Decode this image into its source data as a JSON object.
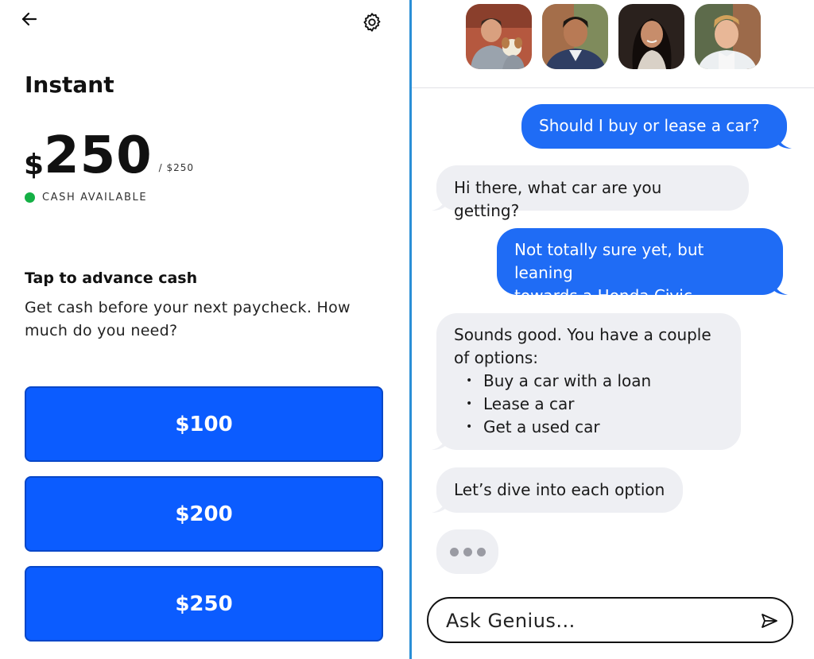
{
  "left": {
    "title": "Instant",
    "currency_symbol": "$",
    "balance": "250",
    "limit": "/ $250",
    "status_label": "CASH AVAILABLE",
    "status_color": "#14b045",
    "section_title": "Tap to advance cash",
    "description": "Get cash before your next paycheck. How much do you need?",
    "amount_buttons": [
      {
        "label": "$100"
      },
      {
        "label": "$200"
      },
      {
        "label": "$250"
      }
    ],
    "accent_color": "#0b5cff",
    "icons": {
      "back": "arrow-left-icon",
      "settings": "gear-icon"
    }
  },
  "right": {
    "advisors": [
      "advisor-1",
      "advisor-2",
      "advisor-3",
      "advisor-4"
    ],
    "messages": [
      {
        "from": "user",
        "text": "Should I buy or lease a car?"
      },
      {
        "from": "assistant",
        "text": "Hi there, what car are you getting?"
      },
      {
        "from": "user",
        "lines": [
          "Not totally sure yet, but leaning",
          "towards a Honda Civic"
        ]
      },
      {
        "from": "assistant",
        "lines": [
          "Sounds good. You have a couple",
          "of options:"
        ],
        "bullets": [
          "Buy a car with a loan",
          "Lease a car",
          "Get a used car"
        ]
      },
      {
        "from": "assistant",
        "text": "Let’s dive into each option"
      }
    ],
    "typing_indicator": true,
    "input": {
      "placeholder": "Ask Genius...",
      "value": ""
    },
    "icons": {
      "send": "send-icon"
    },
    "bubble_out_color": "#1f6cf5",
    "bubble_in_color": "#eeeff3"
  }
}
